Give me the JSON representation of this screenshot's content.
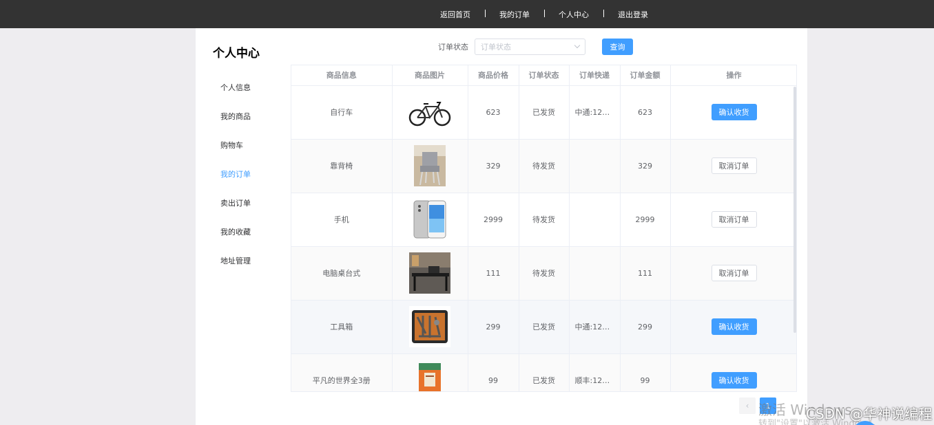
{
  "topnav": {
    "items": [
      "返回首页",
      "我的订单",
      "个人中心",
      "退出登录"
    ]
  },
  "sidebar": {
    "title": "个人中心",
    "items": [
      "个人信息",
      "我的商品",
      "购物车",
      "我的订单",
      "卖出订单",
      "我的收藏",
      "地址管理"
    ],
    "active_index": 3
  },
  "filter": {
    "label": "订单状态",
    "placeholder": "订单状态",
    "query_label": "查询"
  },
  "table": {
    "headers": [
      "商品信息",
      "商品图片",
      "商品价格",
      "订单状态",
      "订单快递",
      "订单金额",
      "操作"
    ],
    "rows": [
      {
        "name": "自行车",
        "image": "bicycle-image",
        "price": "623",
        "status": "已发货",
        "express": "中通:123...",
        "amount": "623",
        "action": "确认收货",
        "action_type": "primary"
      },
      {
        "name": "靠背椅",
        "image": "chair-image",
        "price": "329",
        "status": "待发货",
        "express": "",
        "amount": "329",
        "action": "取消订单",
        "action_type": "plain"
      },
      {
        "name": "手机",
        "image": "phone-image",
        "price": "2999",
        "status": "待发货",
        "express": "",
        "amount": "2999",
        "action": "取消订单",
        "action_type": "plain"
      },
      {
        "name": "电脑桌台式",
        "image": "desk-image",
        "price": "111",
        "status": "待发货",
        "express": "",
        "amount": "111",
        "action": "取消订单",
        "action_type": "plain"
      },
      {
        "name": "工具箱",
        "image": "toolbox-image",
        "price": "299",
        "status": "已发货",
        "express": "中通:123...",
        "amount": "299",
        "action": "确认收货",
        "action_type": "primary"
      },
      {
        "name": "平凡的世界全3册",
        "image": "book-image",
        "price": "99",
        "status": "已发货",
        "express": "顺丰:123...",
        "amount": "99",
        "action": "确认收货",
        "action_type": "primary"
      }
    ]
  },
  "pagination": {
    "prev": "‹",
    "current": "1"
  },
  "overlay": {
    "watermark": "激活 Windows",
    "watermark_sub": "转到\"设置\"以激活 Windows。",
    "credit": "CSDN @华神说编程"
  },
  "colors": {
    "accent": "#409eff",
    "topbar": "#333333"
  }
}
